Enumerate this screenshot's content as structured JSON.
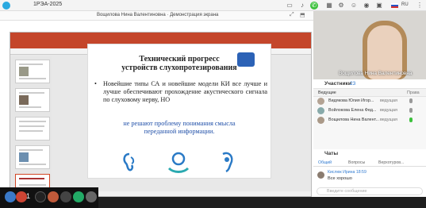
{
  "app": {
    "title": "1РЭА-2025",
    "lang": "RU"
  },
  "share": {
    "title": "Вощилова Нина Валентиновна · Демонстрация экрана"
  },
  "slide": {
    "title_line1": "Технический прогресс",
    "title_line2": "устройств слухопротезирования",
    "bullet": "Новейшие типы СА и новейшие модели КИ все лучше и лучше обеспечивают прохождение акустического сигнала по слуховому нерву, НО",
    "emphasis_line1": "не решают проблему понимания смысла",
    "emphasis_line2": "переданной информации."
  },
  "taskbar": {
    "page": "1"
  },
  "video": {
    "name": "Вощилова Нина Валентиновна"
  },
  "participants": {
    "header": "Участники",
    "count": "23",
    "section": "Ведущие",
    "section_right": "Права",
    "rows": [
      {
        "name": "Видякова Юлия Игор...",
        "role": "ведущая"
      },
      {
        "name": "Войлокова Елена Фед...",
        "role": "ведущая"
      },
      {
        "name": "Вощилова Нина Валент...",
        "role": "ведущая"
      }
    ]
  },
  "chat": {
    "header": "Чаты",
    "tabs": [
      "Общий",
      "Вопросы",
      "Верхотуров..."
    ],
    "message_author": "Кислюк Ирина 18:59",
    "message_text": "Все хорошо",
    "input_placeholder": "Введите сообщение"
  }
}
